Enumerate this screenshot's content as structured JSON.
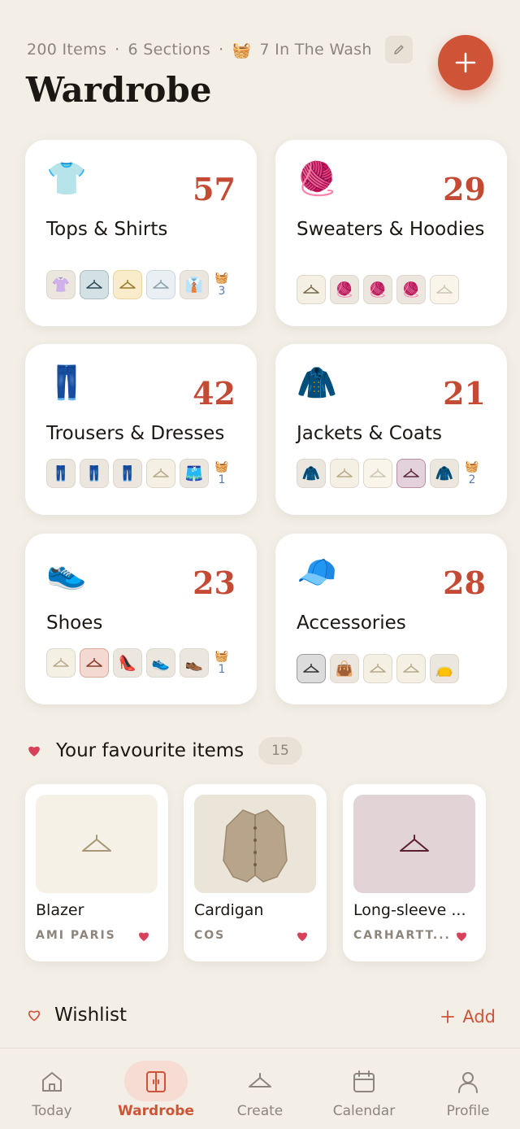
{
  "header": {
    "stats_items": "200 Items",
    "stats_sections": "6 Sections",
    "stats_wash": "7 In The Wash",
    "separator": "·",
    "wash_emoji": "🧺",
    "title": "Wardrobe"
  },
  "categories": [
    {
      "name": "Tops & Shirts",
      "count": "57",
      "emoji": "👕",
      "wash": "3"
    },
    {
      "name": "Sweaters & Hoodies",
      "count": "29",
      "emoji": "🧶",
      "wash": ""
    },
    {
      "name": "Trousers & Dresses",
      "count": "42",
      "emoji": "👖",
      "wash": "1"
    },
    {
      "name": "Jackets & Coats",
      "count": "21",
      "emoji": "🧥",
      "wash": "2"
    },
    {
      "name": "Shoes",
      "count": "23",
      "emoji": "👟",
      "wash": "1"
    },
    {
      "name": "Accessories",
      "count": "28",
      "emoji": "🧢",
      "wash": ""
    }
  ],
  "favourites": {
    "title": "Your favourite items",
    "count": "15",
    "items": [
      {
        "name": "Blazer",
        "brand": "AMI PARIS"
      },
      {
        "name": "Cardigan",
        "brand": "COS"
      },
      {
        "name": "Long-sleeve ...",
        "brand": "CARHARTT..."
      }
    ]
  },
  "wishlist": {
    "title": "Wishlist",
    "add_label": "Add"
  },
  "nav": [
    {
      "label": "Today"
    },
    {
      "label": "Wardrobe"
    },
    {
      "label": "Create"
    },
    {
      "label": "Calendar"
    },
    {
      "label": "Profile"
    }
  ],
  "colors": {
    "accent": "#cf5337",
    "count": "#c44a33",
    "background": "#f3efe7",
    "heart": "#d9415a"
  }
}
